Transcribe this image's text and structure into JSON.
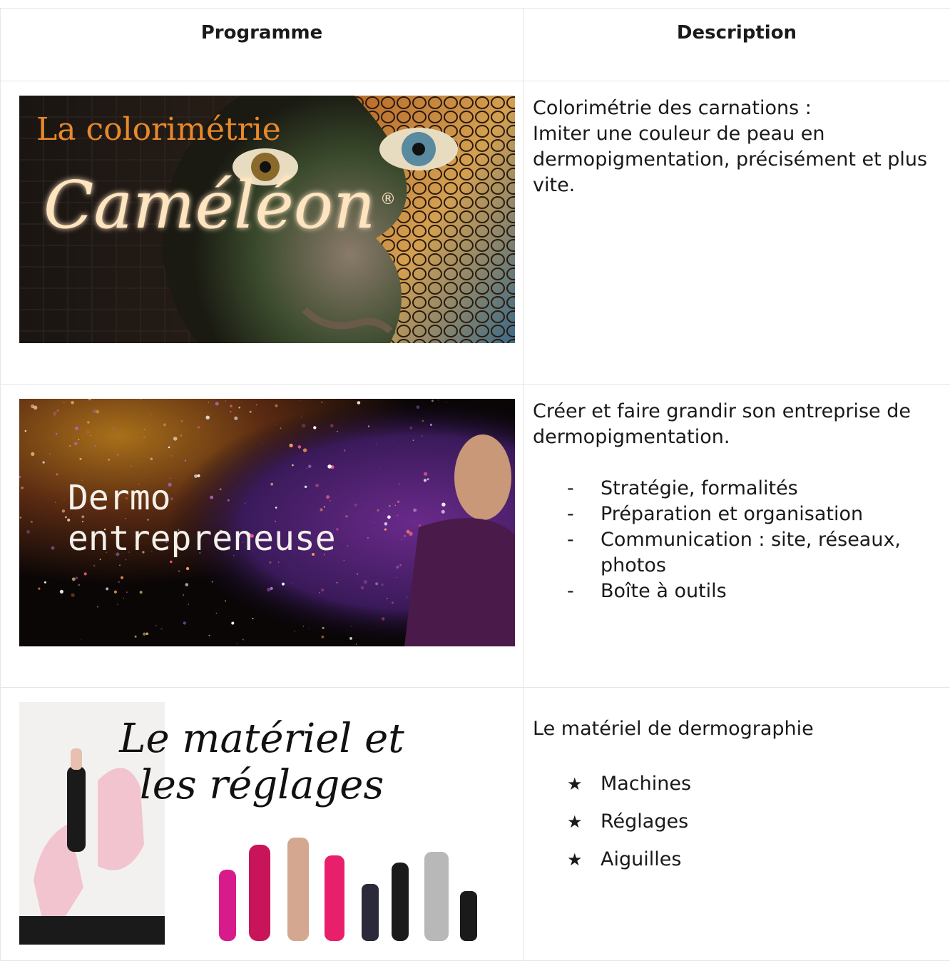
{
  "table": {
    "headers": {
      "programme": "Programme",
      "description": "Description"
    },
    "rows": [
      {
        "image_text": {
          "line1": "La colorimétrie",
          "line2": "Caméléon",
          "mark": "®"
        },
        "description": {
          "title": "Colorimétrie des carnations :",
          "body": "Imiter une couleur de peau en dermopigmentation, précisément et plus vite."
        }
      },
      {
        "image_text": {
          "line1": "Dermo",
          "line2": "entrepreneuse"
        },
        "description": {
          "title": "Créer et faire grandir son entreprise de dermopigmentation.",
          "bullet": "-",
          "items": [
            "Stratégie, formalités",
            "Préparation et organisation",
            "Communication : site, réseaux, photos",
            "Boîte à outils"
          ]
        }
      },
      {
        "image_text": {
          "line1": "Le matériel et",
          "line2": "les réglages"
        },
        "description": {
          "title": "Le matériel de dermographie",
          "bullet": "★",
          "items": [
            "Machines",
            "Réglages",
            "Aiguilles"
          ]
        }
      }
    ]
  },
  "colors": {
    "border": "#e6e6e6",
    "text": "#1a1a1a",
    "glow": "#ffd9a8",
    "orange": "#e8892b"
  }
}
